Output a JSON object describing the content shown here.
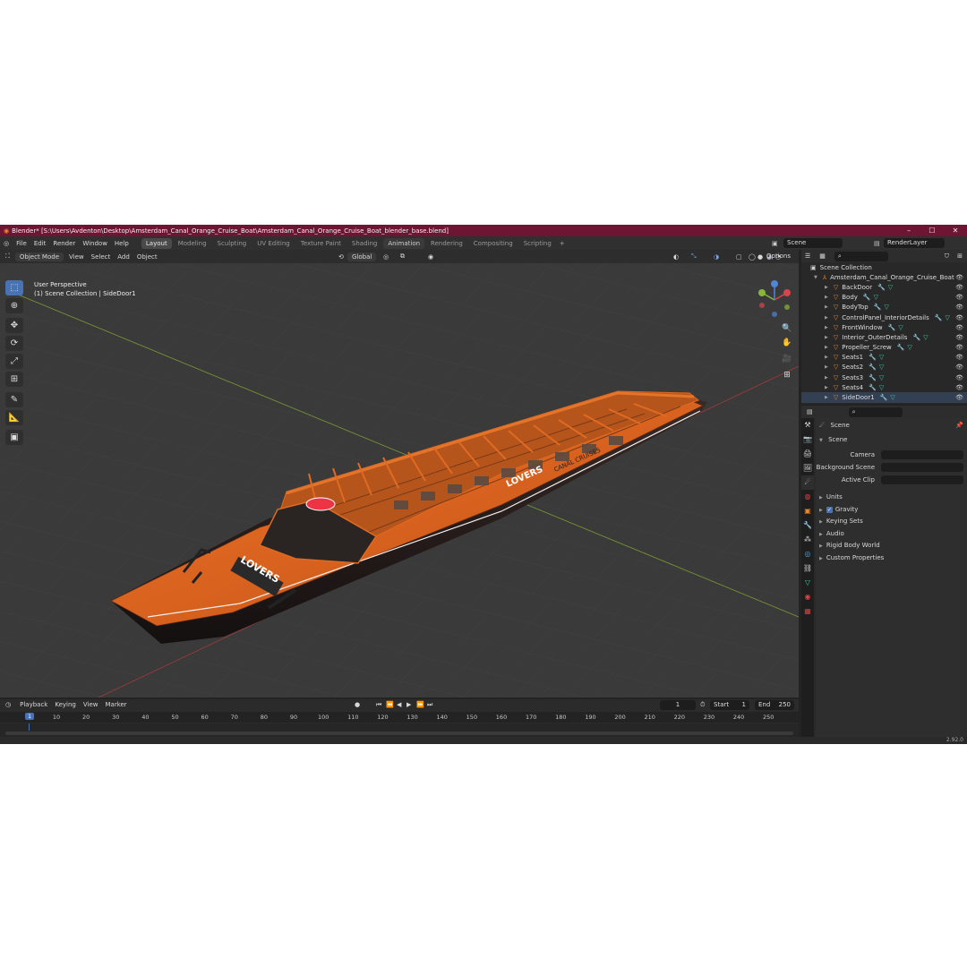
{
  "titlebar": {
    "title": "Blender* [S:\\Users\\Avdenton\\Desktop\\Amsterdam_Canal_Orange_Cruise_Boat\\Amsterdam_Canal_Orange_Cruise_Boat_blender_base.blend]"
  },
  "menu": [
    "File",
    "Edit",
    "Render",
    "Window",
    "Help"
  ],
  "workspaces": [
    "Layout",
    "Modeling",
    "Sculpting",
    "UV Editing",
    "Texture Paint",
    "Shading",
    "Animation",
    "Rendering",
    "Compositing",
    "Scripting"
  ],
  "active_workspace": "Layout",
  "scene_field": "Scene",
  "renderlayer_field": "RenderLayer",
  "viewport": {
    "mode": "Object Mode",
    "menu": [
      "View",
      "Select",
      "Add",
      "Object"
    ],
    "transform": "Global",
    "options": "Options",
    "perspective": "User Perspective",
    "collection_info": "(1) Scene Collection | SideDoor1",
    "boat_text_front": "LOVERS",
    "boat_text_side": "LOVERS",
    "boat_text_side2": "CANAL CRUISES"
  },
  "outliner": {
    "root": "Scene Collection",
    "collection": "Amsterdam_Canal_Orange_Cruise_Boat",
    "objects": [
      "BackDoor",
      "Body",
      "BodyTop",
      "ControlPanel_InteriorDetails",
      "FrontWindow",
      "Interior_OuterDetails",
      "Propeller_Screw",
      "Seats1",
      "Seats2",
      "Seats3",
      "Seats4",
      "SideDoor1"
    ]
  },
  "properties": {
    "header": "Scene",
    "section": "Scene",
    "camera_label": "Camera",
    "bg_scene_label": "Background Scene",
    "active_clip_label": "Active Clip",
    "panels": [
      "Units",
      "Gravity",
      "Keying Sets",
      "Audio",
      "Rigid Body World",
      "Custom Properties"
    ]
  },
  "timeline": {
    "menu": [
      "Playback",
      "Keying",
      "View",
      "Marker"
    ],
    "current_frame": "1",
    "start_label": "Start",
    "start": "1",
    "end_label": "End",
    "end": "250",
    "ticks": [
      "1",
      "10",
      "20",
      "30",
      "40",
      "50",
      "60",
      "70",
      "80",
      "90",
      "100",
      "110",
      "120",
      "130",
      "140",
      "150",
      "160",
      "170",
      "180",
      "190",
      "200",
      "210",
      "220",
      "230",
      "240",
      "250"
    ]
  },
  "version": "2.92.0",
  "colors": {
    "title_bg": "#6d1533",
    "accent": "#4772b3",
    "boat_orange": "#e8621e",
    "mesh_icon": "#3dc8a6",
    "object_icon": "#e8882a"
  }
}
